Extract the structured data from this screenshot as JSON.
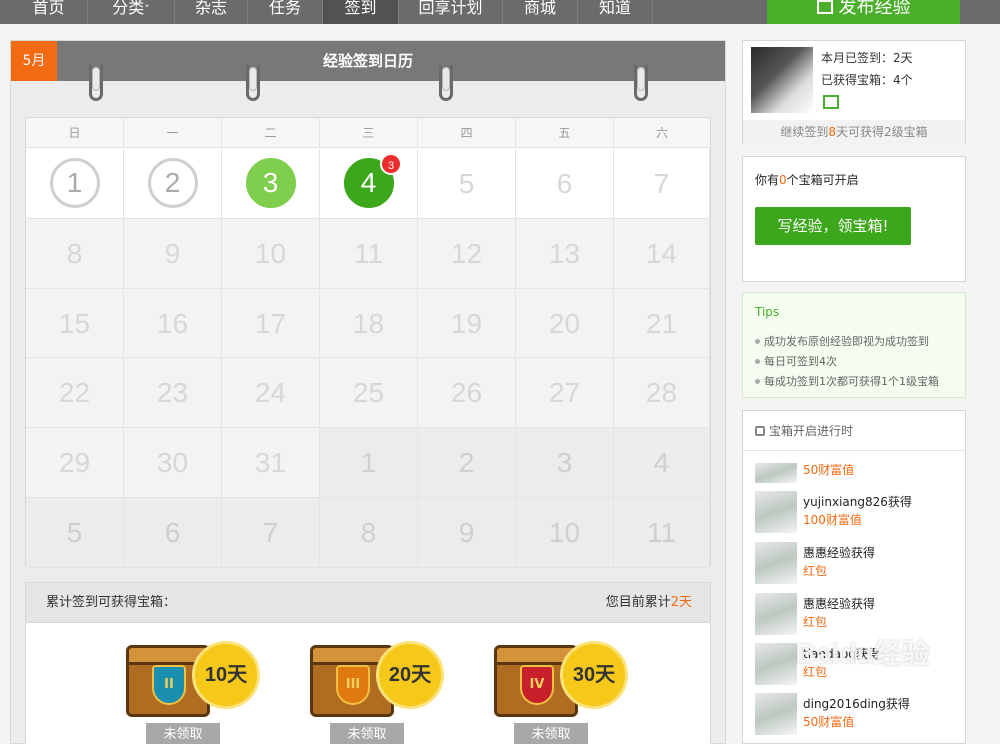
{
  "nav": {
    "items": [
      "首页",
      "分类",
      "杂志",
      "任务",
      "签到",
      "回享计划",
      "商城",
      "知道"
    ],
    "dropdown_caret": "˅",
    "publish": "发布经验"
  },
  "calendar": {
    "month": "5月",
    "title": "经验签到日历",
    "weekdays": [
      "日",
      "一",
      "二",
      "三",
      "四",
      "五",
      "六"
    ],
    "rows": [
      [
        "1",
        "2",
        "3",
        "4",
        "5",
        "6",
        "7"
      ],
      [
        "8",
        "9",
        "10",
        "11",
        "12",
        "13",
        "14"
      ],
      [
        "15",
        "16",
        "17",
        "18",
        "19",
        "20",
        "21"
      ],
      [
        "22",
        "23",
        "24",
        "25",
        "26",
        "27",
        "28"
      ],
      [
        "29",
        "30",
        "31",
        "1",
        "2",
        "3",
        "4"
      ],
      [
        "5",
        "6",
        "7",
        "8",
        "9",
        "10",
        "11"
      ]
    ],
    "day4_badge": "3"
  },
  "chests": {
    "header_left": "累计签到可获得宝箱：",
    "header_right_prefix": "您目前累计",
    "header_right_value": "2天",
    "items": [
      {
        "level": "II",
        "days": "10天",
        "status": "未领取"
      },
      {
        "level": "III",
        "days": "20天",
        "status": "未领取"
      },
      {
        "level": "IV",
        "days": "30天",
        "status": "未领取"
      }
    ]
  },
  "user": {
    "signed_label": "本月已签到：",
    "signed_value": "2天",
    "chests_label": "已获得宝箱：",
    "chests_value": "4个",
    "footer_prefix": "继续签到",
    "footer_days": "8",
    "footer_suffix": "天可获得2级宝箱"
  },
  "chest_box": {
    "prefix": "你有",
    "count": "0",
    "suffix": "个宝箱可开启",
    "button": "写经验，领宝箱!"
  },
  "tips": {
    "title": "Tips",
    "items": [
      "成功发布原创经验即视为成功签到",
      "每日可签到4次",
      "每成功签到1次都可获得1个1级宝箱"
    ]
  },
  "feed": {
    "title": "宝箱开启进行时",
    "items": [
      {
        "name": "",
        "prize": "50财富值"
      },
      {
        "name": "yujinxiang826获得",
        "prize": "100财富值"
      },
      {
        "name": "惠惠经验获得",
        "prize": "红包"
      },
      {
        "name": "惠惠经验获得",
        "prize": "红包"
      },
      {
        "name": "tiandaoq获得",
        "prize": "红包"
      },
      {
        "name": "ding2016ding获得",
        "prize": "50财富值"
      }
    ]
  },
  "watermark": "Baidu经验"
}
